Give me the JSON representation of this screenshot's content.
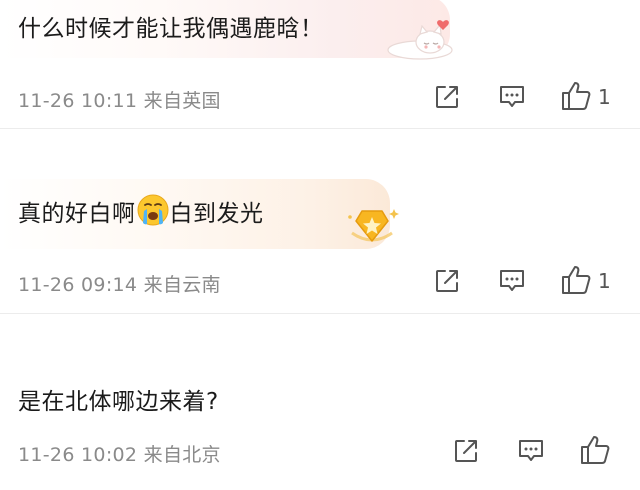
{
  "comments": [
    {
      "text": "什么时候才能让我偶遇鹿晗！",
      "meta": "11-26 10:11 来自英国",
      "likes": "1",
      "background_color": "#fbeeee"
    },
    {
      "text_before": "真的好白啊",
      "emoji_icon": "crying-face-icon",
      "text_after": "白到发光",
      "meta": "11-26 09:14 来自云南",
      "likes": "1",
      "badge_icon": "gold-star-shield-icon",
      "background_color": "#fdf1e6"
    },
    {
      "text": "是在北体哪边来着?",
      "meta": "11-26 10:02 来自北京",
      "likes": ""
    }
  ],
  "icons": {
    "share": "share-icon",
    "comment": "comment-icon",
    "like": "thumbs-up-icon"
  },
  "colors": {
    "text": "#1b1b1b",
    "meta": "#8a8a8a",
    "icon": "#555555",
    "divider": "#ececec"
  }
}
